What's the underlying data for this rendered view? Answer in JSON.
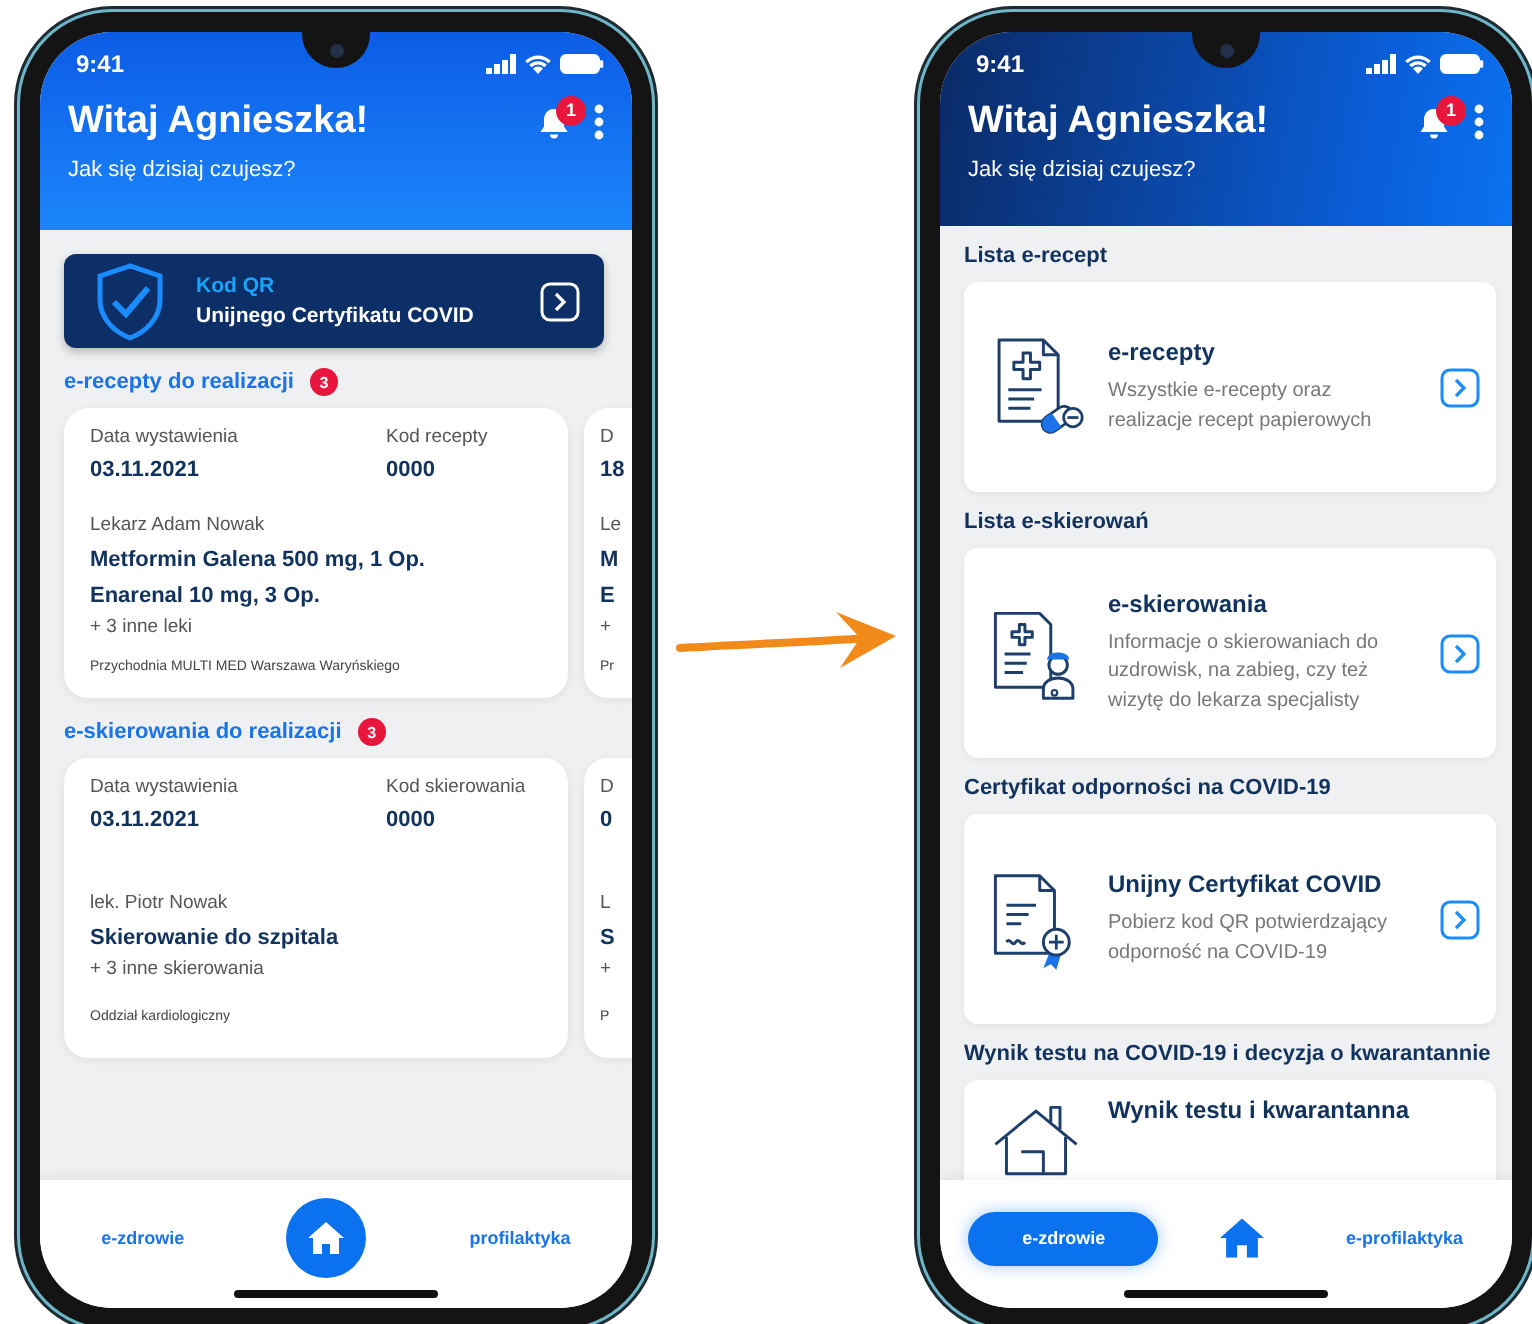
{
  "phones": [
    {
      "kind": "dashboard",
      "status_time": "9:41",
      "greeting": "Witaj Agnieszka!",
      "subtitle": "Jak się dzisiaj czujesz?",
      "notification_count": "1",
      "qr_banner": {
        "title": "Kod QR",
        "subtitle": "Unijnego Certyfikatu COVID"
      },
      "sections": [
        {
          "title": "e-recepty do realizacji",
          "count": "3",
          "cards": [
            {
              "date_label": "Data wystawienia",
              "date": "03.11.2021",
              "code_label": "Kod recepty",
              "code": "0000",
              "doctor": "Lekarz Adam Nowak",
              "items": [
                "Metformin Galena 500 mg, 1 Op.",
                "Enarenal 10 mg, 3 Op."
              ],
              "more": "+ 3 inne leki",
              "place": "Przychodnia MULTI MED Warszawa Waryńskiego"
            },
            {
              "date_label": "D",
              "date": "18",
              "doctor": "Le",
              "items": [
                "M",
                "E"
              ],
              "more": "+",
              "place": "Pr"
            }
          ]
        },
        {
          "title": "e-skierowania do realizacji",
          "count": "3",
          "cards": [
            {
              "date_label": "Data wystawienia",
              "date": "03.11.2021",
              "code_label": "Kod skierowania",
              "code": "0000",
              "doctor": "lek. Piotr Nowak",
              "items": [
                "Skierowanie do szpitala"
              ],
              "more": "+ 3 inne skierowania",
              "place": "Oddział kardiologiczny"
            },
            {
              "date_label": "D",
              "date": "0",
              "doctor": "L",
              "items": [
                "S"
              ],
              "more": "+",
              "place": "P"
            }
          ]
        }
      ],
      "nav": [
        {
          "kind": "text",
          "label": "e-zdrowie",
          "selected": false
        },
        {
          "kind": "home",
          "selected": true
        },
        {
          "kind": "text",
          "label": "profilaktyka",
          "selected": false
        }
      ]
    },
    {
      "kind": "list",
      "status_time": "9:41",
      "greeting": "Witaj Agnieszka!",
      "subtitle": "Jak się dzisiaj czujesz?",
      "notification_count": "1",
      "groups": [
        {
          "heading": "Lista e-recept",
          "title": "e-recepty",
          "description": "Wszystkie e-recepty oraz realizacje recept papierowych",
          "kind": "prescription"
        },
        {
          "heading": "Lista e-skierowań",
          "title": "e-skierowania",
          "description": "Informacje o skierowaniach do uzdrowisk, na zabieg, czy też wizytę do lekarza specjalisty",
          "kind": "referral"
        },
        {
          "heading": "Certyfikat odporności na COVID-19",
          "title": "Unijny Certyfikat COVID",
          "description": "Pobierz kod QR potwierdzający odporność na COVID-19",
          "kind": "certificate"
        },
        {
          "heading": "Wynik testu na COVID-19 i decyzja o kwarantannie",
          "title": "Wynik testu i kwarantanna",
          "kind": "house"
        }
      ],
      "nav": [
        {
          "kind": "text",
          "label": "e-zdrowie",
          "selected": true
        },
        {
          "kind": "home",
          "selected": false
        },
        {
          "kind": "text",
          "label": "e-profilaktyka",
          "selected": false
        }
      ]
    }
  ]
}
